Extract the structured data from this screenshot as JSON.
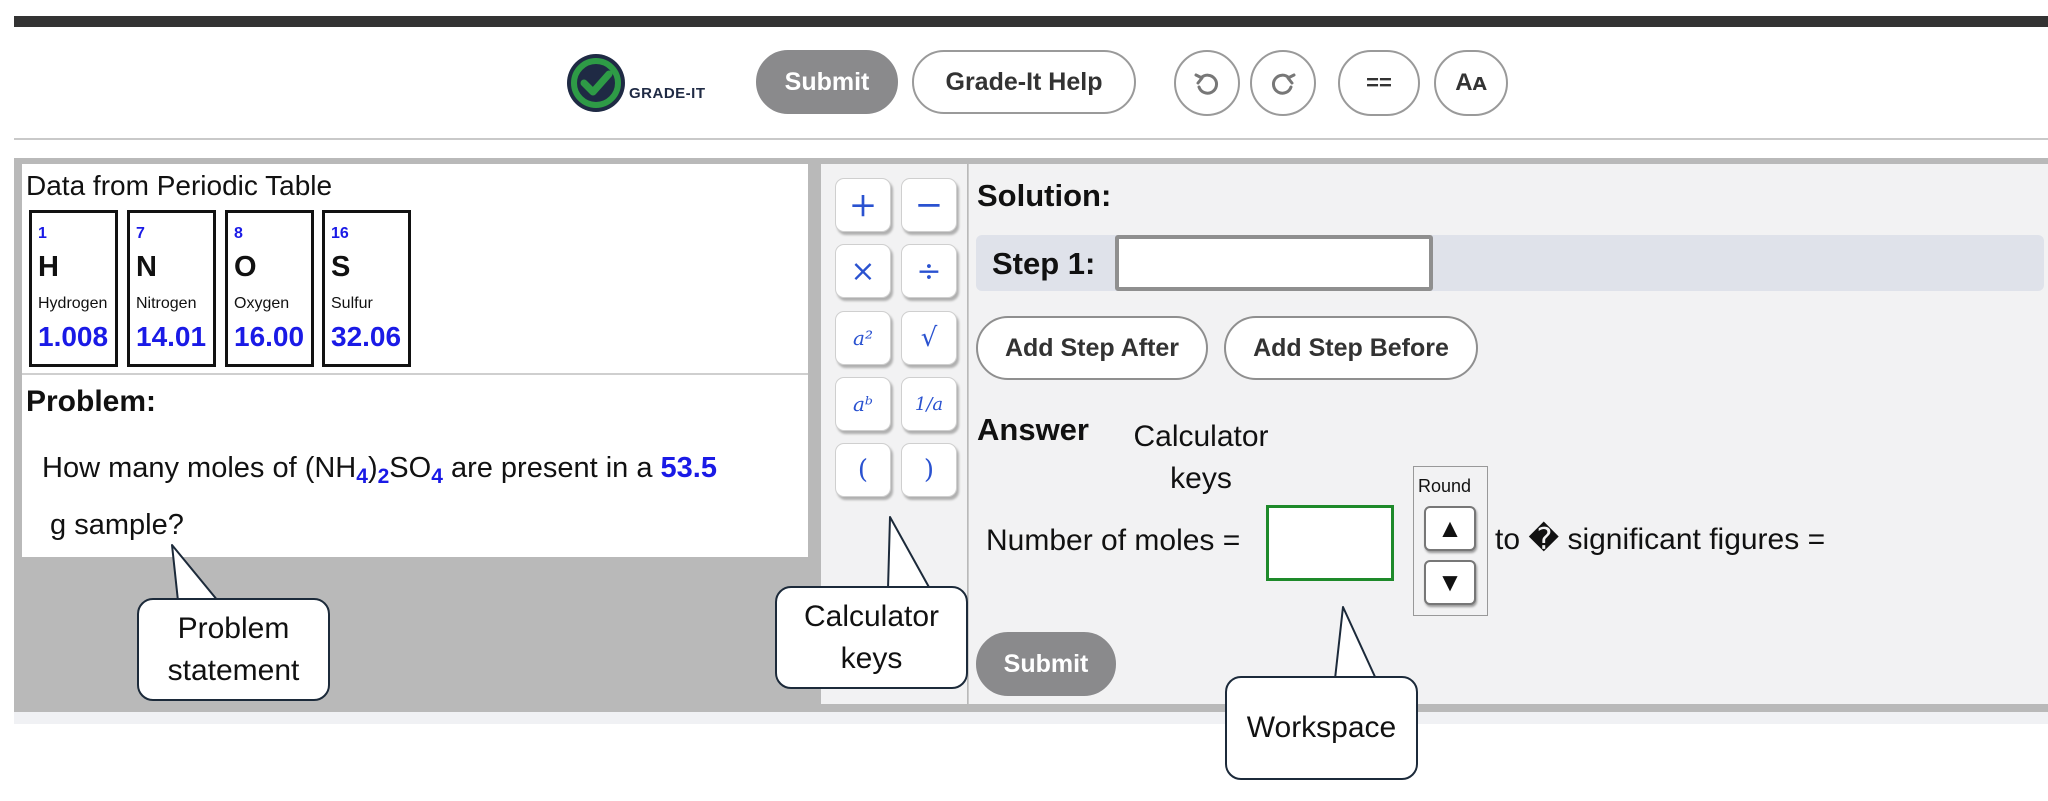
{
  "header": {
    "logo_text": "GRADE-IT",
    "submit_label": "Submit",
    "help_label": "Grade-It Help",
    "undo_icon": "↺",
    "redo_icon": "↻",
    "equals_label": "==",
    "font_size_label": "Aᴀ"
  },
  "periodic_table": {
    "title": "Data from Periodic Table",
    "elements": [
      {
        "number": "1",
        "symbol": "H",
        "name": "Hydrogen",
        "mass": "1.008"
      },
      {
        "number": "7",
        "symbol": "N",
        "name": "Nitrogen",
        "mass": "14.01"
      },
      {
        "number": "8",
        "symbol": "O",
        "name": "Oxygen",
        "mass": "16.00"
      },
      {
        "number": "16",
        "symbol": "S",
        "name": "Sulfur",
        "mass": "32.06"
      }
    ]
  },
  "problem": {
    "title": "Problem:",
    "text_before": "How many moles of (NH",
    "sub1": "4",
    "paren_close": ")",
    "sub2": "2",
    "text_mid": "SO",
    "sub3": "4",
    "text_after": " are present in a ",
    "mass_value": "53.5",
    "text_end": " g sample?"
  },
  "calculator_keys": [
    {
      "key": "plus",
      "label": "+"
    },
    {
      "key": "minus",
      "label": "−"
    },
    {
      "key": "multiply",
      "label": "×"
    },
    {
      "key": "divide",
      "label": "÷"
    },
    {
      "key": "square",
      "label": "a²"
    },
    {
      "key": "sqrt",
      "label": "√"
    },
    {
      "key": "power",
      "label": "aᵇ"
    },
    {
      "key": "reciprocal",
      "label": "1/a"
    },
    {
      "key": "paren-open",
      "label": "("
    },
    {
      "key": "paren-close",
      "label": ")"
    }
  ],
  "workspace": {
    "solution_title": "Solution:",
    "step_label": "Step 1:",
    "add_step_after": "Add Step After",
    "add_step_before": "Add Step Before",
    "answer_title": "Answer",
    "moles_label": "Number of moles =",
    "round_label": "Round",
    "round_up": "▲",
    "round_down": "▼",
    "sigfig_text": "to � significant figures =",
    "submit_label": "Submit"
  },
  "callouts": {
    "problem_statement": [
      "Problem",
      "statement"
    ],
    "calculator_keys_bottom": [
      "Calculator",
      "keys"
    ],
    "calculator_keys_top": [
      "Calculator",
      "keys"
    ],
    "workspace": "Workspace"
  },
  "colors": {
    "accent_blue": "#1a1ae6",
    "key_blue": "#2a52d0",
    "submit_gray": "#8a8a8c",
    "answer_border_green": "#1e8a2a",
    "logo_green": "#2e9b46"
  }
}
